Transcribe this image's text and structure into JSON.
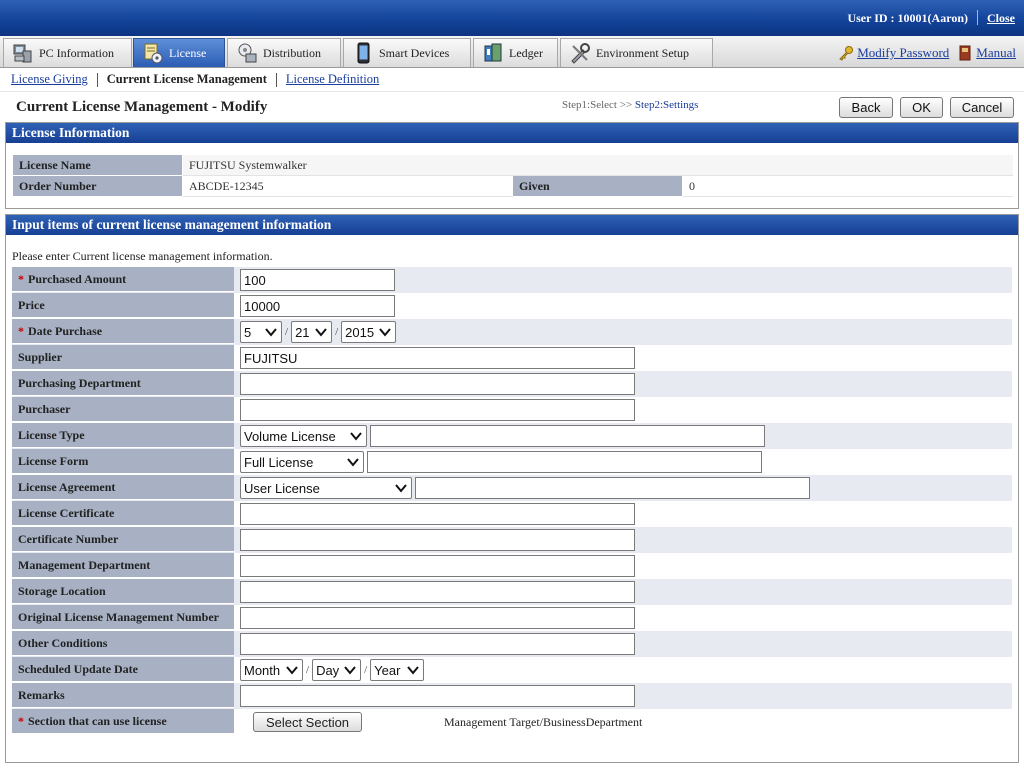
{
  "header": {
    "user_id": "User ID : 10001(Aaron)",
    "close_label": "Close"
  },
  "tabs": [
    {
      "label": "PC Information",
      "icon": "pc-information-icon"
    },
    {
      "label": "License",
      "icon": "license-icon",
      "active": true
    },
    {
      "label": "Distribution",
      "icon": "distribution-icon"
    },
    {
      "label": "Smart Devices",
      "icon": "smart-devices-icon"
    },
    {
      "label": "Ledger",
      "icon": "ledger-icon"
    },
    {
      "label": "Environment Setup",
      "icon": "environment-setup-icon"
    }
  ],
  "toplinks": {
    "modify_password": "Modify Password",
    "manual": "Manual"
  },
  "subnav": {
    "license_giving": "License Giving",
    "current": "Current License Management",
    "license_definition": "License Definition"
  },
  "page": {
    "title": "Current License Management - Modify",
    "step1": "Step1:Select >>",
    "step2": "Step2:Settings",
    "back_label": "Back",
    "ok_label": "OK",
    "cancel_label": "Cancel"
  },
  "license_info": {
    "heading": "License Information",
    "license_name_label": "License Name",
    "license_name": "FUJITSU Systemwalker",
    "order_number_label": "Order Number",
    "order_number": "ABCDE-12345",
    "given_label": "Given",
    "given": "0"
  },
  "form": {
    "heading": "Input items of current license management information",
    "instruction": "Please enter Current license management information.",
    "purchased_amount_label": "Purchased Amount",
    "purchased_amount": "100",
    "price_label": "Price",
    "price": "10000",
    "date_purchase_label": "Date Purchase",
    "date_month": "5",
    "date_day": "21",
    "date_year": "2015",
    "supplier_label": "Supplier",
    "supplier": "FUJITSU",
    "purchasing_department_label": "Purchasing Department",
    "purchasing_department": "",
    "purchaser_label": "Purchaser",
    "purchaser": "",
    "license_type_label": "License Type",
    "license_type": "Volume License",
    "license_type_text": "",
    "license_form_label": "License Form",
    "license_form": "Full License",
    "license_form_text": "",
    "license_agreement_label": "License Agreement",
    "license_agreement": "User License",
    "license_agreement_text": "",
    "license_certificate_label": "License Certificate",
    "license_certificate": "",
    "certificate_number_label": "Certificate Number",
    "certificate_number": "",
    "management_department_label": "Management Department",
    "management_department": "",
    "storage_location_label": "Storage Location",
    "storage_location": "",
    "original_number_label": "Original License Management Number",
    "original_number": "",
    "other_conditions_label": "Other Conditions",
    "other_conditions": "",
    "scheduled_update_label": "Scheduled Update Date",
    "update_month": "Month",
    "update_day": "Day",
    "update_year": "Year",
    "remarks_label": "Remarks",
    "remarks": "",
    "section_label": "Section that can use license",
    "select_section_label": "Select Section",
    "section_value": "Management Target/BusinessDepartment",
    "required_mark": "*",
    "date_separator": "/"
  }
}
